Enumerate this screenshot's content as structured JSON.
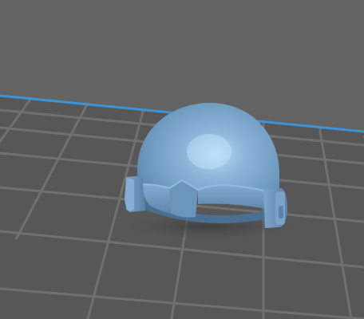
{
  "viewport": {
    "background_color": "#5f5f5f",
    "sky_color": "#646464",
    "bed_color": "#555555",
    "grid_color": "#707070",
    "bed_edge_color": "#3c93d6",
    "model_color": "#6d97bd",
    "model_highlight": "#aad3f2",
    "model_shadow": "#4d7193",
    "model_name": "helmet"
  }
}
